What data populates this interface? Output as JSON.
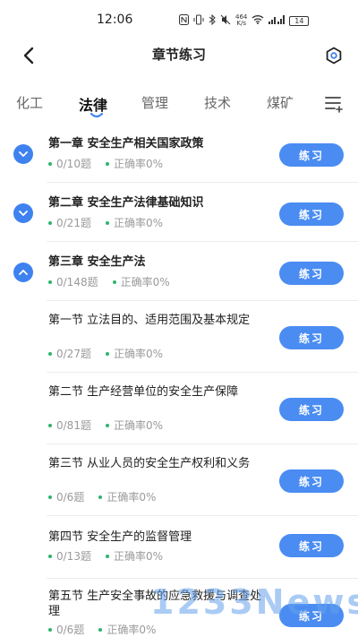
{
  "status_bar": {
    "time": "12:06",
    "network_speed_value": "464",
    "network_speed_unit": "K/s",
    "network_type": "4G",
    "battery": "14"
  },
  "header": {
    "title": "章节练习",
    "back_icon": "chevron-left-icon",
    "settings_icon": "hexagon-settings-icon"
  },
  "tabs": [
    {
      "label": "化工",
      "active": false
    },
    {
      "label": "法律",
      "active": true
    },
    {
      "label": "管理",
      "active": false
    },
    {
      "label": "技术",
      "active": false
    },
    {
      "label": "煤矿",
      "active": false
    }
  ],
  "colors": {
    "accent": "#3e82f0",
    "button": "#4a8cf2",
    "progress_dot": "#2eb56a",
    "meta_text": "#9a9a9a"
  },
  "practice_label": "练习",
  "items": [
    {
      "type": "chapter",
      "expanded": false,
      "title": "第一章 安全生产相关国家政策",
      "progress": "0/10题",
      "accuracy": "正确率0%"
    },
    {
      "type": "chapter",
      "expanded": false,
      "title": "第二章 安全生产法律基础知识",
      "progress": "0/21题",
      "accuracy": "正确率0%"
    },
    {
      "type": "chapter",
      "expanded": true,
      "title": "第三章 安全生产法",
      "progress": "0/148题",
      "accuracy": "正确率0%"
    },
    {
      "type": "section",
      "title": "第一节 立法目的、适用范围及基本规定",
      "progress": "0/27题",
      "accuracy": "正确率0%"
    },
    {
      "type": "section",
      "title": "第二节 生产经营单位的安全生产保障",
      "progress": "0/81题",
      "accuracy": "正确率0%"
    },
    {
      "type": "section",
      "title": "第三节 从业人员的安全生产权利和义务",
      "progress": "0/6题",
      "accuracy": "正确率0%"
    },
    {
      "type": "section",
      "title": "第四节 安全生产的监督管理",
      "progress": "0/13题",
      "accuracy": "正确率0%"
    },
    {
      "type": "section",
      "title": "第五节 生产安全事故的应急救援与调查处理",
      "progress": "0/6题",
      "accuracy": "正确率0%"
    }
  ],
  "watermark": "1233News"
}
